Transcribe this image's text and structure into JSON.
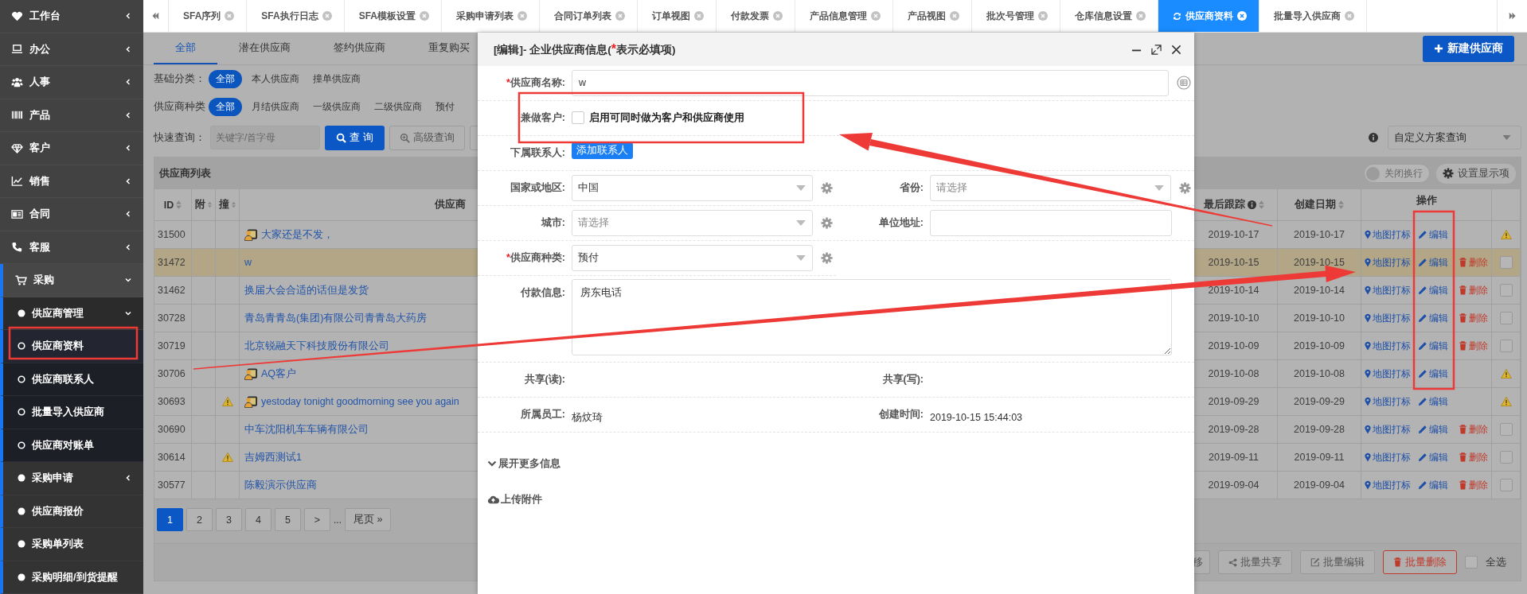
{
  "sidebar": {
    "items": [
      {
        "label": "工作台",
        "expanded": false
      },
      {
        "label": "办公",
        "expanded": false
      },
      {
        "label": "人事",
        "expanded": false
      },
      {
        "label": "产品",
        "expanded": false
      },
      {
        "label": "客户",
        "expanded": false
      },
      {
        "label": "销售",
        "expanded": false
      },
      {
        "label": "合同",
        "expanded": false
      },
      {
        "label": "客服",
        "expanded": false
      },
      {
        "label": "采购",
        "expanded": true,
        "children": [
          {
            "label": "供应商管理",
            "expanded": true,
            "children": [
              {
                "label": "供应商资料",
                "selected": true
              },
              {
                "label": "供应商联系人",
                "selected": false
              },
              {
                "label": "批量导入供应商",
                "selected": false
              },
              {
                "label": "供应商对账单",
                "selected": false
              }
            ]
          },
          {
            "label": "采购申请",
            "expanded": false
          },
          {
            "label": "供应商报价"
          },
          {
            "label": "采购单列表"
          },
          {
            "label": "采购明细/到货提醒"
          }
        ]
      }
    ]
  },
  "tabs": [
    {
      "label": "SFA序列",
      "selected": false
    },
    {
      "label": "SFA执行日志",
      "selected": false
    },
    {
      "label": "SFA模板设置",
      "selected": false
    },
    {
      "label": "采购申请列表",
      "selected": false
    },
    {
      "label": "合同订单列表",
      "selected": false
    },
    {
      "label": "订单视图",
      "selected": false
    },
    {
      "label": "付款发票",
      "selected": false
    },
    {
      "label": "产品信息管理",
      "selected": false
    },
    {
      "label": "产品视图",
      "selected": false
    },
    {
      "label": "批次号管理",
      "selected": false
    },
    {
      "label": "仓库信息设置",
      "selected": false
    },
    {
      "label": "供应商资料",
      "selected": true
    },
    {
      "label": "批量导入供应商",
      "selected": false
    }
  ],
  "subtabs": [
    {
      "label": "全部",
      "selected": true
    },
    {
      "label": "潜在供应商",
      "selected": false
    },
    {
      "label": "签约供应商",
      "selected": false
    },
    {
      "label": "重复购买",
      "selected": false
    }
  ],
  "new_button": "新建供应商",
  "filters": [
    {
      "label": "基础分类：",
      "options": [
        {
          "label": "全部",
          "selected": true
        },
        {
          "label": "本人供应商",
          "selected": false
        },
        {
          "label": "撞单供应商",
          "selected": false
        }
      ]
    },
    {
      "label": "供应商种类",
      "options": [
        {
          "label": "全部",
          "selected": true
        },
        {
          "label": "月结供应商",
          "selected": false
        },
        {
          "label": "一级供应商",
          "selected": false
        },
        {
          "label": "二级供应商",
          "selected": false
        },
        {
          "label": "预付",
          "selected": false
        }
      ]
    }
  ],
  "search": {
    "label": "快速查询：",
    "placeholder": "关键字/首字母",
    "button": "查 询",
    "advanced": "高级查询"
  },
  "scheme_select": {
    "value": "自定义方案查询"
  },
  "table": {
    "title": "供应商列表",
    "wrap_toggle": {
      "label": "关闭换行",
      "on": false
    },
    "settings": "设置显示项",
    "columns": [
      {
        "label": "ID",
        "sortable": true
      },
      {
        "label": "附",
        "sortable": true
      },
      {
        "label": "撞",
        "sortable": true
      },
      {
        "label": "供应商",
        "sortable": false
      },
      {
        "label": "最后跟踪",
        "sortable": true,
        "info": true
      },
      {
        "label": "创建日期",
        "sortable": true
      },
      {
        "label": "操作",
        "sortable": false
      }
    ],
    "rows": [
      {
        "id": "31500",
        "collision": false,
        "contact_icon": true,
        "name": "大家还是不发，",
        "last_follow": "2019-10-17",
        "created": "2019-10-17",
        "map": "地图打标",
        "edit": "编辑",
        "kind": "warning",
        "selected": false
      },
      {
        "id": "31472",
        "collision": false,
        "contact_icon": false,
        "name": "w",
        "last_follow": "2019-10-15",
        "created": "2019-10-15",
        "map": "地图打标",
        "edit": "编辑",
        "delete": "删除",
        "kind": "checkbox",
        "checked": false,
        "selected": true
      },
      {
        "id": "31462",
        "collision": false,
        "contact_icon": false,
        "name": "换届大会合适的话但是发货",
        "last_follow": "2019-10-14",
        "created": "2019-10-14",
        "map": "地图打标",
        "edit": "编辑",
        "delete": "删除",
        "kind": "checkbox",
        "checked": false,
        "selected": false
      },
      {
        "id": "30728",
        "collision": false,
        "contact_icon": false,
        "name": "青岛青青岛(集团)有限公司青青岛大药房",
        "last_follow": "2019-10-10",
        "created": "2019-10-10",
        "map": "地图打标",
        "edit": "编辑",
        "delete": "删除",
        "kind": "checkbox",
        "checked": false,
        "selected": false
      },
      {
        "id": "30719",
        "collision": false,
        "contact_icon": false,
        "name": "北京锐融天下科技股份有限公司",
        "last_follow": "2019-10-09",
        "created": "2019-10-09",
        "map": "地图打标",
        "edit": "编辑",
        "delete": "删除",
        "kind": "checkbox",
        "checked": false,
        "selected": false
      },
      {
        "id": "30706",
        "collision": false,
        "contact_icon": true,
        "name": "AQ客户",
        "last_follow": "2019-10-08",
        "created": "2019-10-08",
        "map": "地图打标",
        "edit": "编辑",
        "kind": "warning",
        "selected": false
      },
      {
        "id": "30693",
        "collision": true,
        "contact_icon": true,
        "name": "yestoday tonight goodmorning see you again",
        "last_follow": "2019-09-29",
        "created": "2019-09-29",
        "map": "地图打标",
        "edit": "编辑",
        "kind": "warning",
        "selected": false
      },
      {
        "id": "30690",
        "collision": false,
        "contact_icon": false,
        "name": "中车沈阳机车车辆有限公司",
        "last_follow": "2019-09-28",
        "created": "2019-09-28",
        "map": "地图打标",
        "edit": "编辑",
        "delete": "删除",
        "kind": "checkbox",
        "checked": false,
        "selected": false
      },
      {
        "id": "30614",
        "collision": true,
        "contact_icon": false,
        "name": "吉姆西测试1",
        "last_follow": "2019-09-11",
        "created": "2019-09-11",
        "map": "地图打标",
        "edit": "编辑",
        "delete": "删除",
        "kind": "checkbox",
        "checked": false,
        "selected": false
      },
      {
        "id": "30577",
        "collision": false,
        "contact_icon": false,
        "name": "陈毅演示供应商",
        "last_follow": "2019-09-04",
        "created": "2019-09-04",
        "map": "地图打标",
        "edit": "编辑",
        "delete": "删除",
        "kind": "checkbox",
        "checked": false,
        "selected": false
      }
    ]
  },
  "pagination": {
    "pages": [
      {
        "label": "1",
        "selected": true
      },
      {
        "label": "2",
        "selected": false
      },
      {
        "label": "3",
        "selected": false
      },
      {
        "label": "4",
        "selected": false
      },
      {
        "label": "5",
        "selected": false
      },
      {
        "label": ">",
        "selected": false
      }
    ],
    "ellipsis": "...",
    "last": "尾页 »"
  },
  "batch": {
    "buttons": [
      {
        "kind": "move",
        "label": "移"
      },
      {
        "kind": "share",
        "label": "批量共享"
      },
      {
        "kind": "edit",
        "label": "批量编辑"
      },
      {
        "kind": "delete",
        "label": "批量删除"
      }
    ],
    "select_all": {
      "label": "全选",
      "checked": false
    }
  },
  "modal": {
    "title_prefix": "[编辑]- 企业供应商信息(",
    "required_mark": "*",
    "title_suffix": "表示必填项)",
    "rows": [
      [
        {
          "label": "供应商名称:",
          "required": true,
          "kind": "name",
          "value": "w"
        }
      ],
      [
        {
          "label": "兼做客户:",
          "required": false,
          "kind": "checkbox",
          "checked": false,
          "text": "启用可同时做为客户和供应商使用"
        }
      ],
      [
        {
          "label": "下属联系人:",
          "required": false,
          "kind": "button",
          "text": "添加联系人"
        }
      ],
      [
        {
          "label": "国家或地区:",
          "required": false,
          "kind": "select",
          "value": "中国"
        },
        {
          "label": "省份:",
          "required": false,
          "kind": "select",
          "placeholder": "请选择"
        }
      ],
      [
        {
          "label": "城市:",
          "required": false,
          "kind": "select",
          "placeholder": "请选择"
        },
        {
          "label": "单位地址:",
          "required": false,
          "kind": "input"
        }
      ],
      [
        {
          "label": "供应商种类:",
          "required": true,
          "kind": "select",
          "value": "预付"
        }
      ],
      [
        {
          "label": "付款信息:",
          "required": false,
          "kind": "textarea",
          "value": "房东电话"
        }
      ],
      [
        {
          "label": "共享(读):",
          "required": false,
          "kind": "text"
        },
        {
          "label": "共享(写):",
          "required": false,
          "kind": "text"
        }
      ],
      [
        {
          "label": "所属员工:",
          "required": false,
          "kind": "text",
          "value": "杨炆琦"
        },
        {
          "label": "创建时间:",
          "required": false,
          "kind": "text",
          "value": "2019-10-15 15:44:03"
        }
      ]
    ],
    "sections": [
      {
        "kind": "expand",
        "label": "展开更多信息"
      },
      {
        "kind": "upload",
        "label": "上传附件"
      }
    ]
  }
}
